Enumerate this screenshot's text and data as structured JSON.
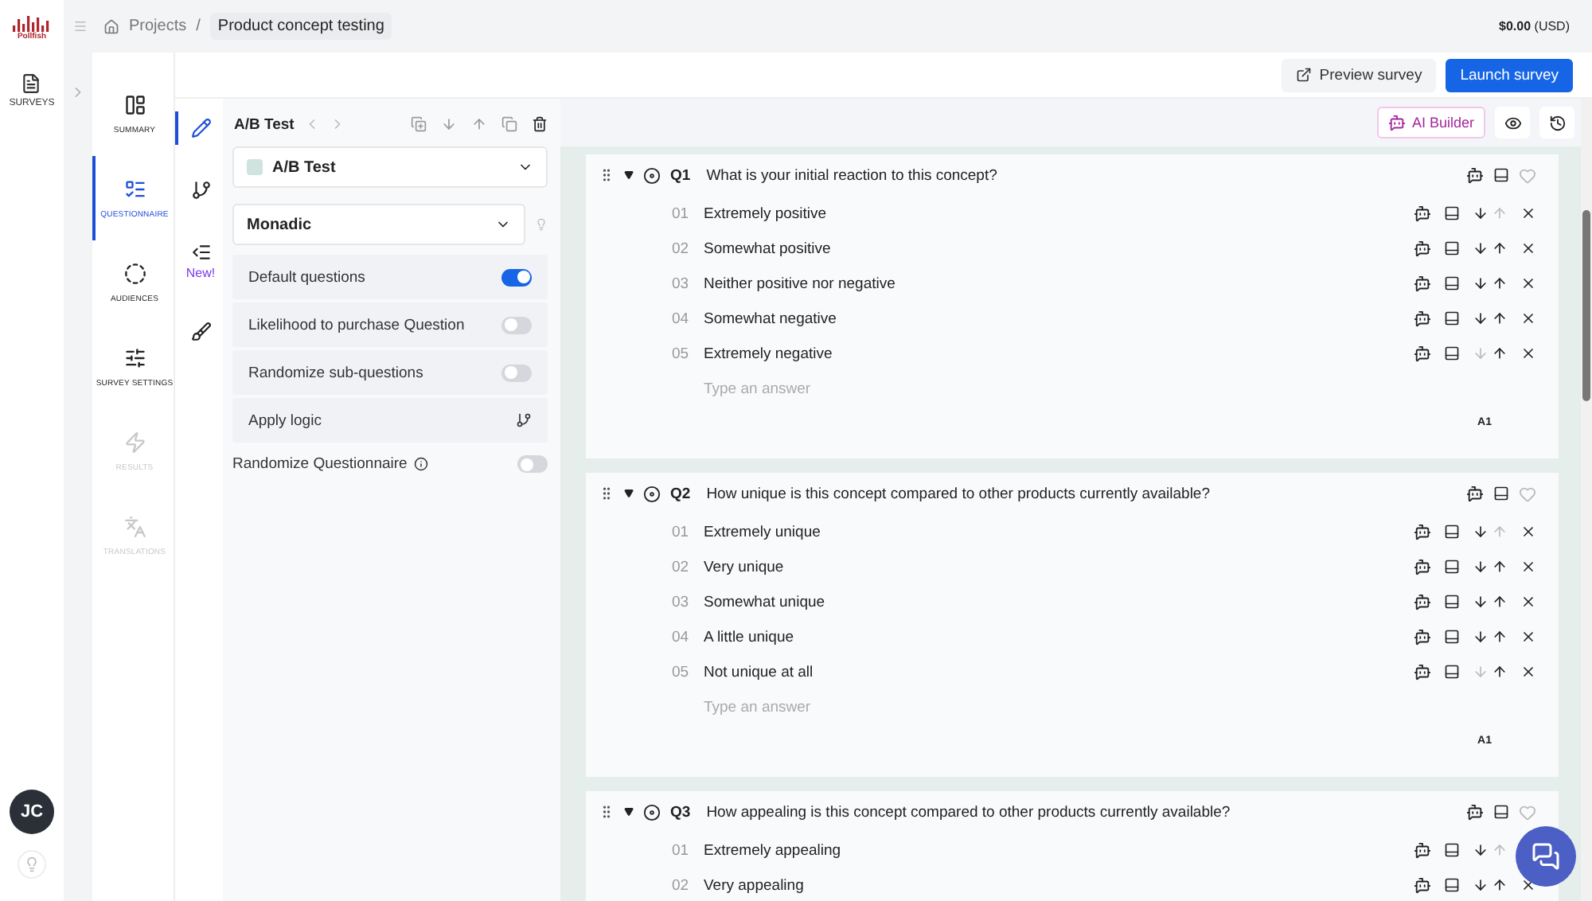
{
  "brand": {
    "name": "Pollfish"
  },
  "rail": {
    "items": [
      {
        "label": "SURVEYS",
        "selected": false
      }
    ],
    "avatar": "JC"
  },
  "breadcrumb": {
    "items": [
      "Projects",
      "Product concept testing"
    ],
    "separator": "/"
  },
  "balance": {
    "amount": "$0.00",
    "currency": "(USD)"
  },
  "header_buttons": [
    {
      "label": "Preview survey",
      "kind": "secondary"
    },
    {
      "label": "Launch survey",
      "kind": "primary"
    }
  ],
  "nav": [
    {
      "label": "SUMMARY",
      "selected": false,
      "disabled": false
    },
    {
      "label": "QUESTIONNAIRE",
      "selected": true,
      "disabled": false
    },
    {
      "label": "AUDIENCES",
      "selected": false,
      "disabled": false
    },
    {
      "label": "SURVEY SETTINGS",
      "selected": false,
      "disabled": false
    },
    {
      "label": "RESULTS",
      "selected": false,
      "disabled": true
    },
    {
      "label": "TRANSLATIONS",
      "selected": false,
      "disabled": true
    }
  ],
  "subnav": [
    {
      "selected": true
    },
    {
      "selected": false
    },
    {
      "selected": false,
      "badge": "New!"
    },
    {
      "selected": false
    }
  ],
  "panel": {
    "title": "A/B Test",
    "block_select": "A/B Test",
    "method_select": "Monadic",
    "options": [
      {
        "kind": "toggle",
        "label": "Default questions",
        "on": true
      },
      {
        "kind": "toggle",
        "label": "Likelihood to purchase Question",
        "on": false
      },
      {
        "kind": "toggle",
        "label": "Randomize sub-questions",
        "on": false
      },
      {
        "kind": "logic",
        "label": "Apply logic"
      }
    ],
    "randomize": {
      "label": "Randomize Questionnaire",
      "on": false
    }
  },
  "toolbar": {
    "ai_label": "AI Builder"
  },
  "questions": [
    {
      "number": "Q1",
      "text": "What is your initial reaction to this concept?",
      "footer": "A1",
      "placeholder": "Type an answer",
      "answers": [
        {
          "number": "01",
          "text": "Extremely positive",
          "can_move_up": false,
          "can_move_down": true
        },
        {
          "number": "02",
          "text": "Somewhat positive",
          "can_move_up": true,
          "can_move_down": true
        },
        {
          "number": "03",
          "text": "Neither positive nor negative",
          "can_move_up": true,
          "can_move_down": true
        },
        {
          "number": "04",
          "text": "Somewhat negative",
          "can_move_up": true,
          "can_move_down": true
        },
        {
          "number": "05",
          "text": "Extremely negative",
          "can_move_up": true,
          "can_move_down": false
        }
      ]
    },
    {
      "number": "Q2",
      "text": "How unique is this concept compared to other products currently available?",
      "footer": "A1",
      "placeholder": "Type an answer",
      "answers": [
        {
          "number": "01",
          "text": "Extremely unique",
          "can_move_up": false,
          "can_move_down": true
        },
        {
          "number": "02",
          "text": "Very unique",
          "can_move_up": true,
          "can_move_down": true
        },
        {
          "number": "03",
          "text": "Somewhat unique",
          "can_move_up": true,
          "can_move_down": true
        },
        {
          "number": "04",
          "text": "A little unique",
          "can_move_up": true,
          "can_move_down": true
        },
        {
          "number": "05",
          "text": "Not unique at all",
          "can_move_up": true,
          "can_move_down": false
        }
      ]
    },
    {
      "number": "Q3",
      "text": "How appealing is this concept compared to other products currently available?",
      "answers": [
        {
          "number": "01",
          "text": "Extremely appealing",
          "can_move_up": false,
          "can_move_down": true
        },
        {
          "number": "02",
          "text": "Very appealing",
          "can_move_up": true,
          "can_move_down": true
        }
      ]
    }
  ]
}
